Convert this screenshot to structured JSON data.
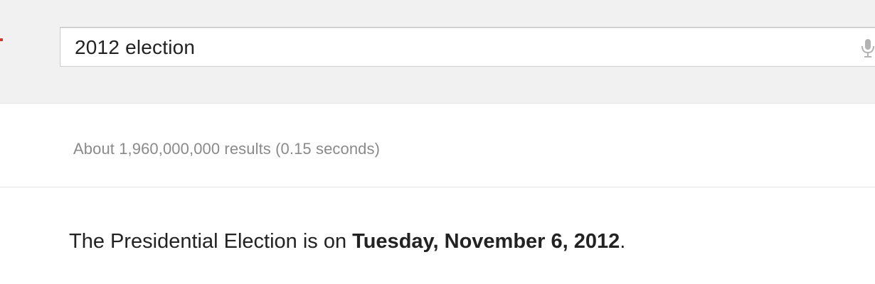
{
  "search": {
    "query": "2012 election",
    "mic_icon": "microphone-icon"
  },
  "logo": {
    "fragment_color": "#d03a2a"
  },
  "results": {
    "stats": "About 1,960,000,000 results (0.15 seconds)"
  },
  "answer_box": {
    "prefix": "The Presidential Election is on ",
    "date": "Tuesday, November 6, 2012",
    "suffix": "."
  }
}
